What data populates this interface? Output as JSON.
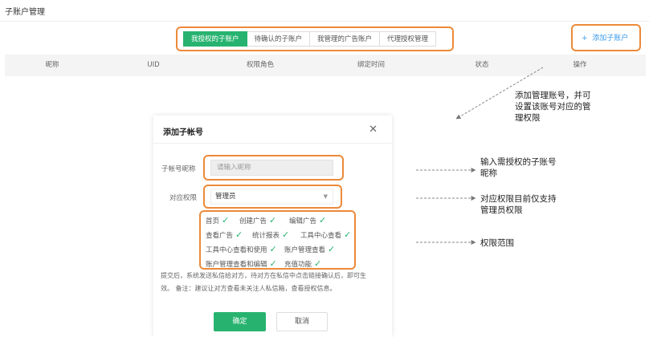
{
  "header": {
    "title": "子账户管理"
  },
  "tabs": [
    {
      "label": "我授权的子账户",
      "active": true
    },
    {
      "label": "待确认的子账户",
      "active": false
    },
    {
      "label": "我管理的广告账户",
      "active": false
    },
    {
      "label": "代理授权管理",
      "active": false
    }
  ],
  "add_button": {
    "label": "添加子账户",
    "icon": "plus-icon"
  },
  "table": {
    "columns": [
      "昵称",
      "UID",
      "权限角色",
      "绑定时间",
      "状态",
      "操作"
    ]
  },
  "annotations": {
    "add": [
      "添加管理账号，并可",
      "设置该账号对应的管",
      "理权限"
    ],
    "name": [
      "输入需授权的子账号",
      "昵称"
    ],
    "role": [
      "对应权限目前仅支持",
      "管理员权限"
    ],
    "scope": [
      "权限范围"
    ]
  },
  "modal": {
    "title": "添加子帐号",
    "name_label": "子帐号昵称",
    "name_placeholder": "请输入昵称",
    "role_label": "对应权限",
    "role_value": "管理员",
    "permissions": [
      [
        "首页",
        "创建广告",
        "编辑广告"
      ],
      [
        "查看广告",
        "统计报表",
        "工具中心查看"
      ],
      [
        "工具中心查看和使用",
        "账户管理查看"
      ],
      [
        "账户管理查看和编辑",
        "充值功能"
      ]
    ],
    "tip": [
      "提交后，系统发送私信给对方，待对方在私信中点击链接确认后，即可生",
      "效。 备注：建议让对方查看未关注人私信箱，查看授权信息。"
    ],
    "confirm_label": "确定",
    "cancel_label": "取消"
  },
  "colors": {
    "accent_green": "#27b36f",
    "highlight_orange": "#ec8a3a",
    "link_blue": "#3a9be8"
  }
}
